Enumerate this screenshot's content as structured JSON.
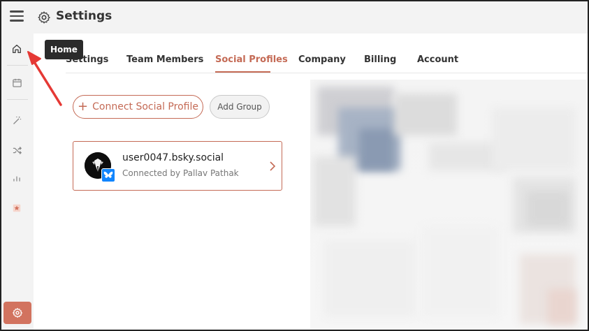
{
  "header": {
    "title": "Settings",
    "menu_icon": "hamburger-icon",
    "title_icon": "gear-icon"
  },
  "rail": {
    "items": [
      {
        "icon": "home-icon"
      },
      {
        "icon": "calendar-icon"
      },
      {
        "icon": "magic-wand-icon"
      },
      {
        "icon": "shuffle-icon"
      },
      {
        "icon": "bar-chart-icon"
      },
      {
        "icon": "star-badge-icon"
      }
    ],
    "settings_icon": "gear-icon"
  },
  "tooltip": {
    "text": "Home"
  },
  "tabs": {
    "items": [
      {
        "label": "Settings"
      },
      {
        "label": "Team Members"
      },
      {
        "label": "Social Profiles"
      },
      {
        "label": "Company"
      },
      {
        "label": "Billing"
      },
      {
        "label": "Account"
      }
    ],
    "active": "Social Profiles"
  },
  "actions": {
    "connect_label": "Connect Social Profile",
    "connect_icon": "plus-icon",
    "group_label": "Add Group"
  },
  "profile": {
    "handle": "user0047.bsky.social",
    "connected_by": "Connected by Pallav Pathak",
    "network_icon": "bluesky-butterfly-icon",
    "open_icon": "chevron-right-icon"
  },
  "colors": {
    "accent": "#c46a55",
    "rail_active": "#d2735f",
    "arrow": "#e53935",
    "bluesky": "#1185fe"
  }
}
